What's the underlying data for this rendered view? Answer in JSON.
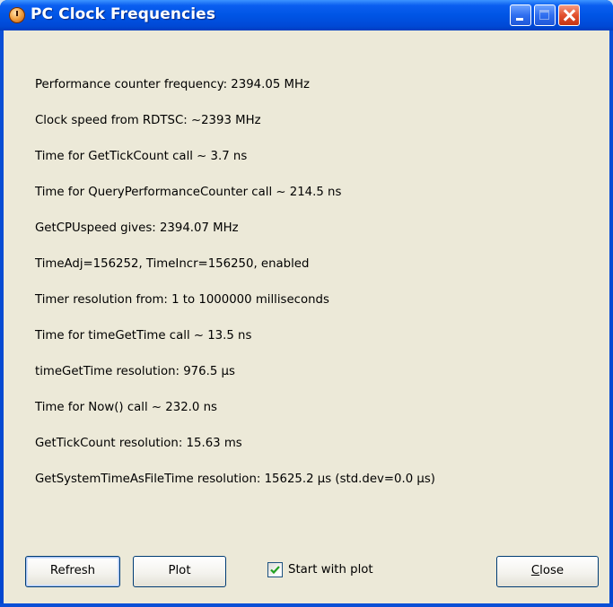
{
  "window": {
    "title": "PC Clock Frequencies",
    "icon": "clock-app-icon",
    "controls": [
      "minimize-icon",
      "maximize-icon",
      "close-icon"
    ],
    "colors": {
      "titlebar": "#0055e5",
      "client_bg": "#ece9d8",
      "close_button": "#e2512e"
    }
  },
  "info_lines": [
    "Performance counter frequency: 2394.05 MHz",
    "Clock speed from RDTSC: ~2393 MHz",
    "Time for GetTickCount call ~ 3.7 ns",
    "Time for QueryPerformanceCounter call ~ 214.5 ns",
    "GetCPUspeed gives: 2394.07 MHz",
    "TimeAdj=156252, TimeIncr=156250, enabled",
    "Timer resolution from: 1 to 1000000 milliseconds",
    "Time for timeGetTime call ~ 13.5 ns",
    "timeGetTime resolution: 976.5 µs",
    "Time for Now() call ~ 232.0 ns",
    "GetTickCount resolution: 15.63 ms",
    "GetSystemTimeAsFileTime resolution: 15625.2 µs  (std.dev=0.0 µs)"
  ],
  "buttons": {
    "refresh": "Refresh",
    "plot": "Plot",
    "close_first": "C",
    "close_rest": "lose"
  },
  "checkbox": {
    "label": "Start with plot",
    "checked": true
  }
}
